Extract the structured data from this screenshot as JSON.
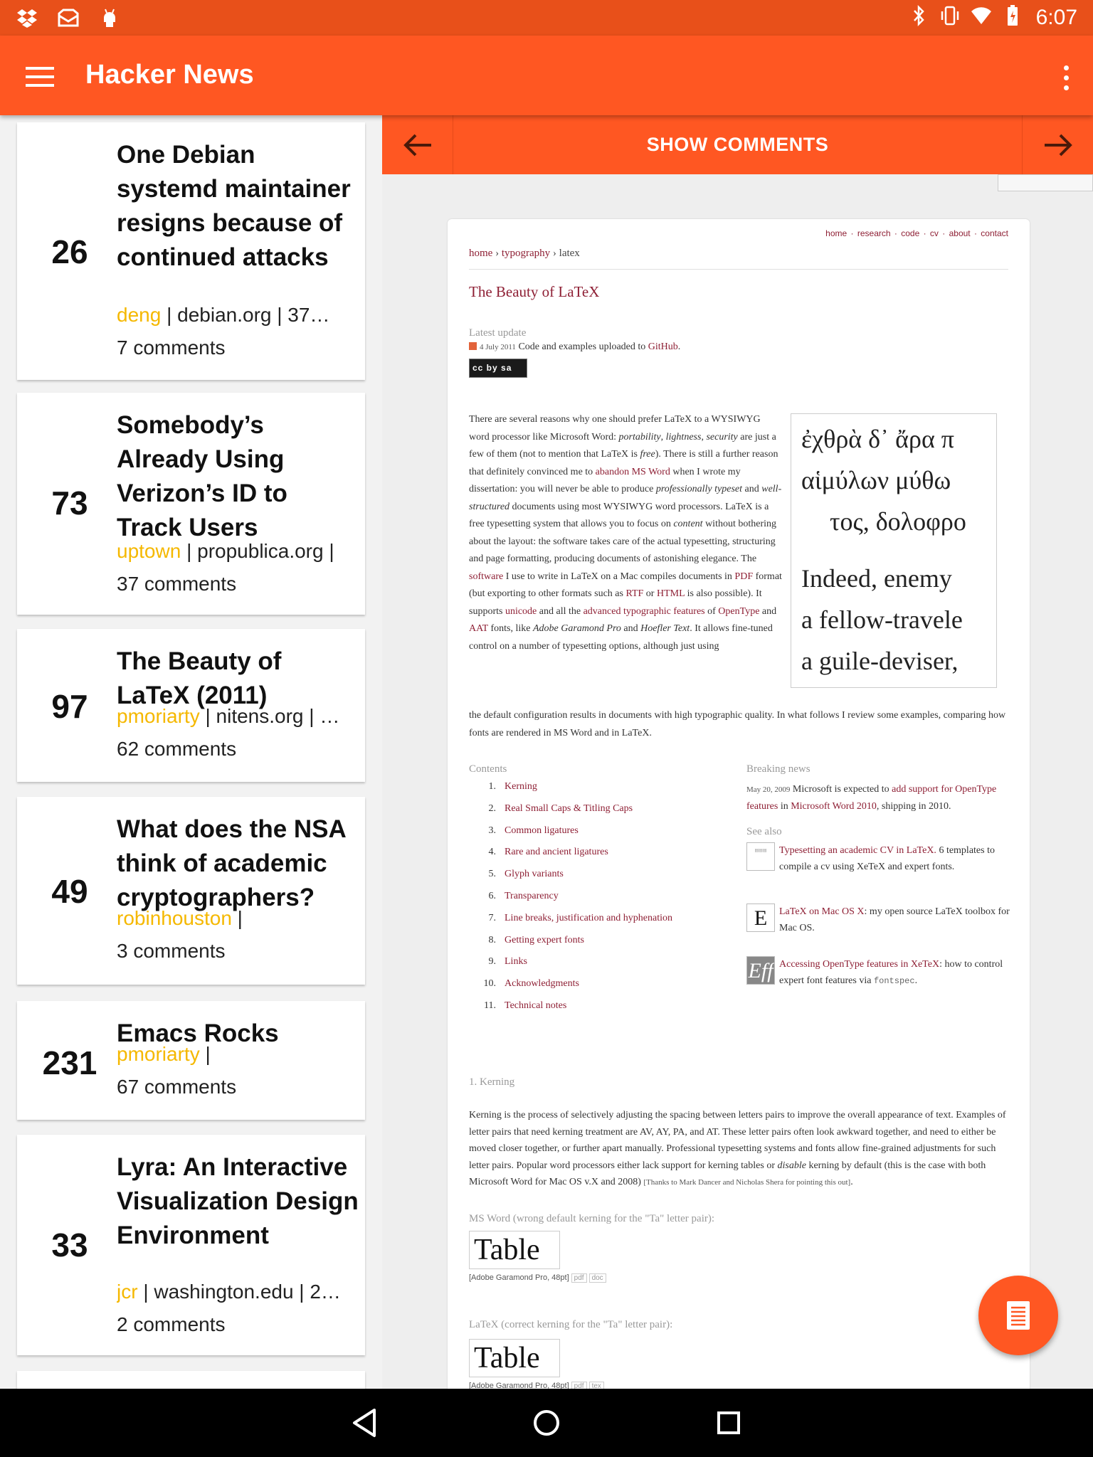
{
  "status_bar": {
    "time": "6:07"
  },
  "app_bar": {
    "title": "Hacker News"
  },
  "stories": [
    {
      "score": "26",
      "title": "One Debian systemd maintainer resigns because of continued attacks",
      "user": "deng",
      "meta_rest": " | debian.org | 37…",
      "comments": "7 comments"
    },
    {
      "score": "73",
      "title": "Somebody’s Already Using Verizon’s ID to Track Users",
      "user": "uptown",
      "meta_rest": " | propublica.org |",
      "comments": "37 comments"
    },
    {
      "score": "97",
      "title": "The Beauty of LaTeX (2011)",
      "user": "pmoriarty",
      "meta_rest": " | nitens.org | …",
      "comments": "62 comments"
    },
    {
      "score": "49",
      "title": "What does the NSA think of academic cryptographers?",
      "user": "robinhouston",
      "meta_rest": " |",
      "comments": "3 comments"
    },
    {
      "score": "231",
      "title": "Emacs Rocks",
      "user": "pmoriarty",
      "meta_rest": " |",
      "comments": "67 comments"
    },
    {
      "score": "33",
      "title": "Lyra: An Interactive Visualization Design Environment",
      "user": "jcr",
      "meta_rest": " | washington.edu | 2…",
      "comments": "2 comments"
    }
  ],
  "detail_bar": {
    "show_comments": "SHOW COMMENTS"
  },
  "web": {
    "nav": [
      "home",
      "research",
      "code",
      "cv",
      "about",
      "contact"
    ],
    "crumb_home": "home",
    "crumb_typo": "typography",
    "crumb_current": "latex",
    "title": "The Beauty of LaTeX",
    "latest_label": "Latest update",
    "update_date": "4 July 2011",
    "update_text": "Code and examples uploaded to",
    "update_link": "GitHub",
    "cc_text": "cc by sa",
    "greek": [
      "ἐχθρὰ δ᾽ ἄρα π",
      "αἱμύλων μύθω",
      "τος, δολοφρο",
      "Indeed, enemy",
      "a fellow-travele",
      "a guile-deviser,"
    ],
    "contents_label": "Contents",
    "toc": [
      "Kerning",
      "Real Small Caps & Titling Caps",
      "Common ligatures",
      "Rare and ancient ligatures",
      "Glyph variants",
      "Transparency",
      "Line breaks, justification and hyphenation",
      "Getting expert fonts",
      "Links",
      "Acknowledgments",
      "Technical notes"
    ],
    "breaking_label": "Breaking news",
    "news_date": "May 20, 2009",
    "news_text_1": "Microsoft is expected to",
    "news_link_1": "add support for OpenType features",
    "news_text_2": "in",
    "news_link_2": "Microsoft Word 2010",
    "news_text_3": ", shipping in 2010.",
    "see_also_label": "See also",
    "see1_link": "Typesetting an academic CV in LaTeX.",
    "see1_text": "6 templates to compile a cv using XeTeX and expert fonts.",
    "see2_link": "LaTeX on Mac OS X",
    "see2_text": ": my open source LaTeX toolbox for Mac OS.",
    "see3_link": "Accessing OpenType features in XeTeX",
    "see3_text": ": how to control expert font features via",
    "see3_code": "fontspec",
    "kerning_head": "1. Kerning",
    "msword_caption": "MS Word (wrong default kerning for the \"Ta\" letter pair):",
    "latex_caption": "LaTeX (correct kerning for the \"Ta\" letter pair):",
    "table_word": "Table",
    "font_caption": "[Adobe Garamond Pro, 48pt]",
    "tag_pdf": "pdf",
    "tag_doc": "doc",
    "tag_tex": "tex"
  }
}
